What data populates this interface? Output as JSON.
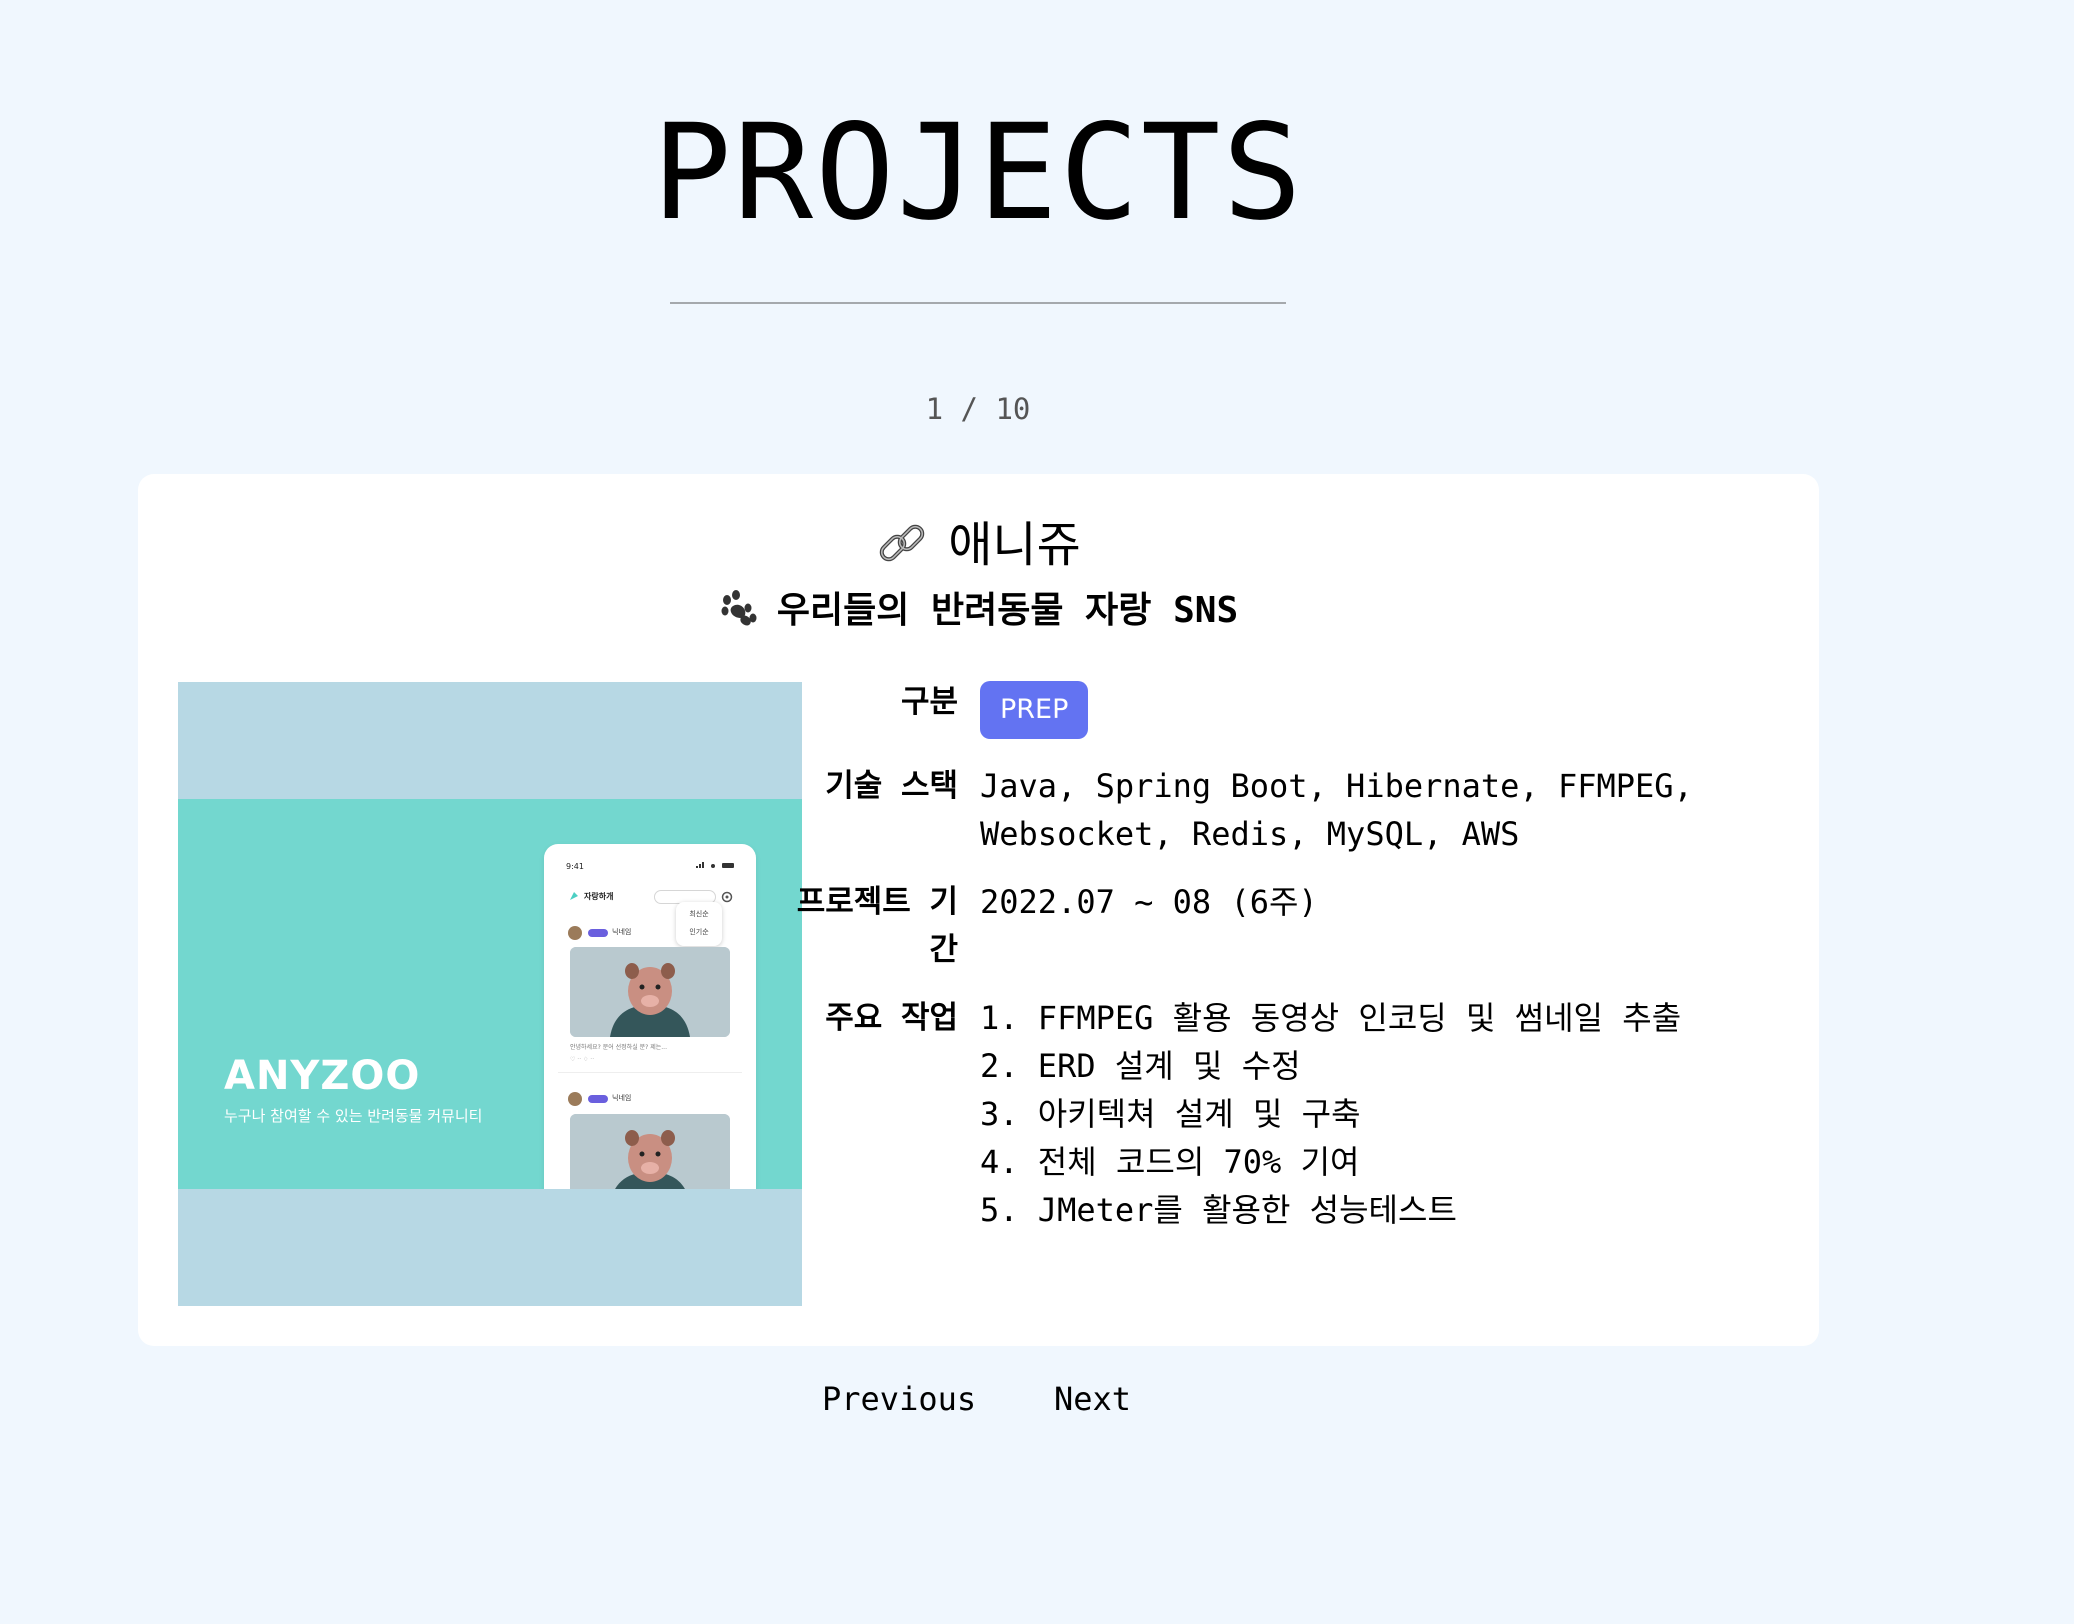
{
  "header": {
    "title": "PROJECTS",
    "counter": "1 / 10"
  },
  "project": {
    "icon": "link-icon",
    "name": "애니쥬",
    "subtitle_icon": "paw-icon",
    "subtitle": "우리들의 반려동물 자랑 SNS",
    "thumbnail": {
      "brand": "ANYZOO",
      "tagline": "누구나 참여할 수 있는 반려동물 커뮤니티",
      "phone": {
        "time": "9:41",
        "app_title": "자랑하개",
        "sort_options": [
          "최신순",
          "인기순"
        ],
        "posts": [
          {
            "nickname": "닉네임",
            "text": "안녕하세요? 문어 선정하실 분? 제는..."
          },
          {
            "nickname": "닉네임",
            "text": ""
          }
        ]
      },
      "colors": {
        "outer": "#b7d8e4",
        "band": "#73d7cf"
      }
    },
    "fields": {
      "type_label": "구분",
      "type_value": "PREP",
      "stack_label": "기술 스택",
      "stack_line1": "Java, Spring Boot, Hibernate, FFMPEG,",
      "stack_line2": "Websocket, Redis, MySQL, AWS",
      "period_label": "프로젝트 기간",
      "period_value": "2022.07 ~ 08 (6주)",
      "tasks_label": "주요 작업",
      "tasks": [
        "1. FFMPEG 활용 동영상 인코딩 및 썸네일 추출",
        "2. ERD 설계 및 수정",
        "3. 아키텍쳐 설계 및 구축",
        "4. 전체 코드의 70% 기여",
        "5. JMeter를 활용한 성능테스트"
      ]
    }
  },
  "nav": {
    "previous": "Previous",
    "next": "Next"
  },
  "colors": {
    "background": "#f0f7fe",
    "card": "#ffffff",
    "badge": "#6373f2"
  }
}
